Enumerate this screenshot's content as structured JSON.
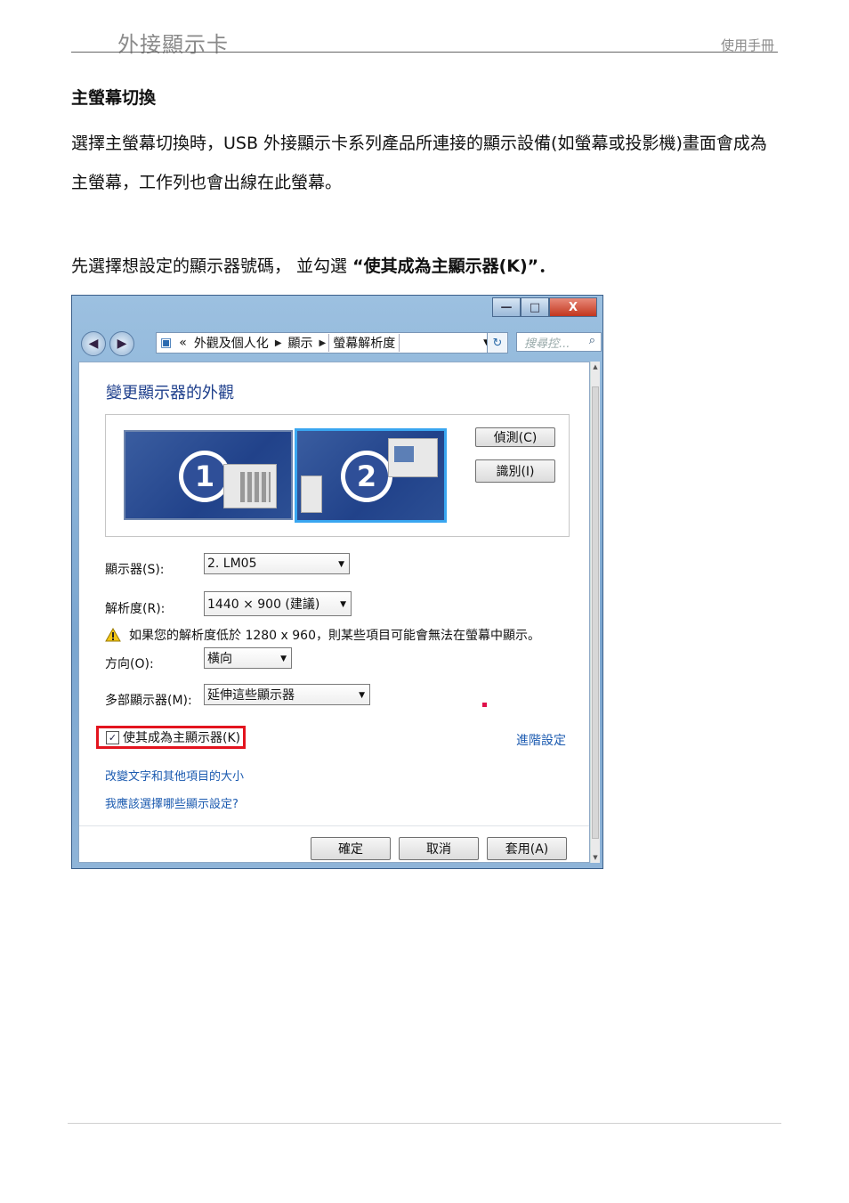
{
  "header": {
    "title": "外接顯示卡",
    "right": "使用手冊"
  },
  "section_title": "主螢幕切換",
  "paragraph": "選擇主螢幕切換時，USB 外接顯示卡系列產品所連接的顯示設備(如螢幕或投影機)畫面會成為主螢幕，工作列也會出線在此螢幕。",
  "instruction": {
    "prefix": "先選擇想設定的顯示器號碼，  並勾選 ",
    "bold": "“使其成為主顯示器(K)”．"
  },
  "window": {
    "controls": {
      "minimize": "—",
      "maximize": "□",
      "close": "X"
    },
    "breadcrumb": {
      "prefix": "«",
      "items": [
        "外觀及個人化",
        "顯示",
        "螢幕解析度"
      ]
    },
    "search_placeholder": "搜尋控...",
    "content_title": "變更顯示器的外觀",
    "monitors": [
      "1",
      "2"
    ],
    "detect_button": "偵測(C)",
    "identify_button": "識別(I)",
    "display_label": "顯示器(S):",
    "display_value": "2. LM05",
    "resolution_label": "解析度(R):",
    "resolution_value": "1440 × 900 (建議)",
    "warning_text": "如果您的解析度低於 1280 x 960，則某些項目可能會無法在螢幕中顯示。",
    "orientation_label": "方向(O):",
    "orientation_value": "橫向",
    "multi_label": "多部顯示器(M):",
    "multi_value": "延伸這些顯示器",
    "primary_checkbox": "使其成為主顯示器(K)",
    "primary_checked": true,
    "advanced_link": "進階設定",
    "link1": "改變文字和其他項目的大小",
    "link2": "我應該選擇哪些顯示設定?",
    "ok_button": "確定",
    "cancel_button": "取消",
    "apply_button": "套用(A)"
  }
}
